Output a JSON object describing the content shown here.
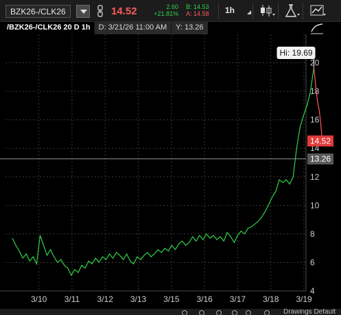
{
  "toolbar": {
    "symbol": "BZK26-/CLK26",
    "last_price": "14.52",
    "net_change": "2.60",
    "pct_change": "+21.81%",
    "bid": "B: 14.53",
    "ask": "A: 14.58",
    "timeframe": "1h"
  },
  "chart_header": {
    "study_name": "/BZK26-/CLK26 20 D 1h",
    "date_readout": "D: 3/21/26 11:00 AM",
    "y_readout": "Y: 13.26"
  },
  "bottom": {
    "status_text": "Drawings Default"
  },
  "colors": {
    "up": "#2fd34a",
    "down": "#ff5a5a",
    "background": "#000000",
    "grid": "#3a3a3a"
  },
  "chart_data": {
    "type": "line",
    "x_ticks": [
      "3/10",
      "3/11",
      "3/12",
      "3/13",
      "3/15",
      "3/16",
      "3/17",
      "3/18",
      "3/19"
    ],
    "y_ticks": [
      "4",
      "6",
      "8",
      "10",
      "12",
      "14",
      "16",
      "18",
      "20"
    ],
    "ylim": [
      4,
      22
    ],
    "high_label": "Hi: 19.69",
    "high_value": 19.69,
    "last_badge": "14.52",
    "crosshair_badge": "13.26",
    "crosshair_value": 13.26,
    "grid": true,
    "series": [
      {
        "color": "up",
        "values": [
          7.7,
          7.2,
          6.8,
          6.3,
          6.6,
          6.1,
          6.4,
          5.9,
          7.9,
          7.2,
          6.5,
          6.9,
          6.4,
          6.0,
          6.2,
          5.8,
          5.6,
          5.1,
          5.5,
          5.3,
          5.8,
          5.6,
          6.1,
          5.9,
          6.3,
          6.0,
          6.4,
          6.2,
          6.6,
          6.3,
          6.7,
          6.5,
          6.2,
          6.6,
          6.1,
          5.9,
          6.4,
          6.2,
          6.5,
          6.7,
          6.4,
          6.6,
          6.9,
          6.7,
          7.0,
          6.8,
          7.2,
          6.9,
          7.3,
          7.5,
          7.2,
          7.4,
          7.8,
          7.5,
          7.9,
          7.6,
          8.0,
          7.7,
          7.9,
          7.6,
          7.8,
          7.5,
          8.1,
          7.8,
          7.4,
          7.9,
          8.2,
          8.0,
          8.4,
          8.5,
          8.7,
          8.9,
          9.2,
          9.6,
          10.1,
          10.6,
          11.0,
          11.8,
          11.6,
          11.8,
          11.5,
          12.0,
          14.0,
          15.5,
          16.3,
          17.0,
          18.0,
          19.69
        ],
        "x_from": 0.0,
        "x_to": 9.1
      },
      {
        "color": "down",
        "values": [
          19.69,
          18.5,
          17.4,
          16.8,
          15.9,
          14.52
        ],
        "x_from": 9.1,
        "x_to": 9.35
      }
    ]
  }
}
